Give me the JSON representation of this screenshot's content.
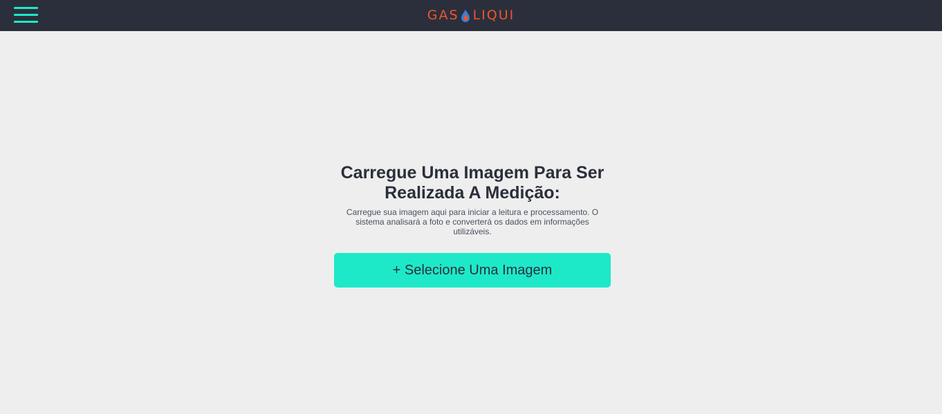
{
  "header": {
    "menu_icon": "hamburger-menu-icon",
    "logo": {
      "left_text": "GAS",
      "right_text": "LIQUI",
      "icon": "flame-drop-icon",
      "colors": {
        "text": "#f2542d",
        "drop_blue": "#2f7fe0",
        "drop_orange": "#f2542d"
      }
    }
  },
  "main": {
    "heading": "Carregue Uma Imagem Para Ser Realizada A Medição:",
    "description": "Carregue sua imagem aqui para iniciar a leitura e processamento. O sistema analisará a foto e converterá os dados em informações utilizáveis.",
    "select_button_label": "+ Selecione Uma Imagem"
  },
  "colors": {
    "topbar": "#2b2f3b",
    "accent": "#1de9c9",
    "background": "#eeeeee",
    "heading": "#2b2f3b"
  }
}
